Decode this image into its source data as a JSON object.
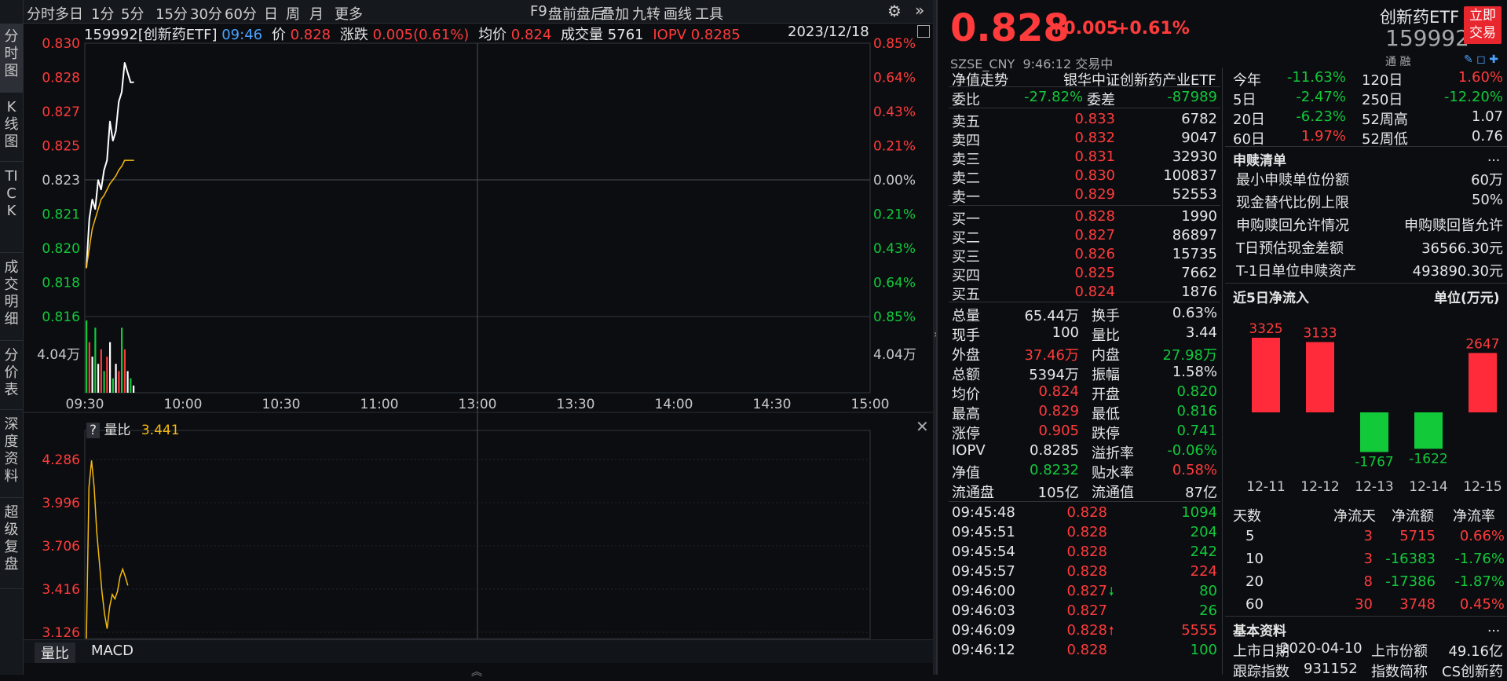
{
  "sidebar": {
    "tabs": [
      "分时图",
      "K线图",
      "TICK",
      "成交明细",
      "分价表",
      "深度资料",
      "超级复盘"
    ]
  },
  "toolbar": {
    "periods": [
      "分时",
      "多日",
      "1分",
      "5分",
      "15分",
      "30分",
      "60分",
      "日",
      "周",
      "月",
      "更多"
    ],
    "tools": [
      "F9",
      "盘前盘后",
      "叠加",
      "九转",
      "画线",
      "工具"
    ]
  },
  "infobar": {
    "code": "159992[创新药ETF]",
    "time": "09:46",
    "price_label": "价",
    "price": "0.828",
    "change_label": "涨跌",
    "change": "0.005(0.61%)",
    "avg_label": "均价",
    "avg": "0.824",
    "volume_label": "成交量",
    "volume": "5761",
    "iopv_label": "IOPV",
    "iopv": "0.8285",
    "date": "2023/12/18"
  },
  "price_axis": {
    "left": [
      "0.830",
      "0.828",
      "0.827",
      "0.825",
      "0.823",
      "0.821",
      "0.820",
      "0.818",
      "0.816"
    ],
    "right": [
      "0.85%",
      "0.64%",
      "0.43%",
      "0.21%",
      "0.00%",
      "0.21%",
      "0.43%",
      "0.64%",
      "0.85%"
    ],
    "vol_left": "4.04万",
    "vol_right": "4.04万"
  },
  "time_axis": [
    "09:30",
    "10:00",
    "10:30",
    "11:00",
    "13:00",
    "13:30",
    "14:00",
    "14:30",
    "15:00"
  ],
  "sub_chart": {
    "q": "?",
    "label": "量比",
    "value": "3.441",
    "ticks": [
      "4.286",
      "3.996",
      "3.706",
      "3.416",
      "3.126"
    ]
  },
  "bottom_tabs": [
    "量比",
    "MACD"
  ],
  "chart_data": [
    {
      "type": "line",
      "title": "",
      "ylim": [
        0.816,
        0.83
      ],
      "x": [
        "09:30",
        "09:31",
        "09:32",
        "09:33",
        "09:34",
        "09:35",
        "09:36",
        "09:37",
        "09:38",
        "09:39",
        "09:40",
        "09:41",
        "09:42",
        "09:43",
        "09:44",
        "09:45",
        "09:46"
      ],
      "series": [
        {
          "name": "价",
          "values": [
            0.8185,
            0.821,
            0.822,
            0.8215,
            0.823,
            0.8225,
            0.8235,
            0.824,
            0.826,
            0.825,
            0.8255,
            0.827,
            0.8275,
            0.829,
            0.8285,
            0.828,
            0.828
          ]
        },
        {
          "name": "均价",
          "values": [
            0.8185,
            0.8195,
            0.8205,
            0.821,
            0.8215,
            0.822,
            0.8222,
            0.8225,
            0.8228,
            0.823,
            0.8232,
            0.8235,
            0.8237,
            0.824,
            0.824,
            0.824,
            0.824
          ]
        }
      ]
    },
    {
      "type": "line",
      "title": "量比",
      "ylim": [
        2.9,
        4.35
      ],
      "x": [
        "09:30",
        "09:31",
        "09:32",
        "09:33",
        "09:34",
        "09:35",
        "09:36",
        "09:37",
        "09:38",
        "09:39",
        "09:40",
        "09:41",
        "09:42",
        "09:43",
        "09:44",
        "09:45",
        "09:46"
      ],
      "series": [
        {
          "name": "量比",
          "values": [
            2.9,
            4.1,
            4.28,
            4.1,
            3.8,
            3.6,
            3.4,
            3.25,
            3.15,
            3.3,
            3.38,
            3.35,
            3.4,
            3.5,
            3.55,
            3.5,
            3.44
          ]
        }
      ]
    },
    {
      "type": "bar",
      "title": "近5日净流入",
      "ylabel": "单位(万元)",
      "categories": [
        "12-11",
        "12-12",
        "12-13",
        "12-14",
        "12-15"
      ],
      "values": [
        3325,
        3133,
        -1767,
        -1622,
        2647
      ]
    }
  ],
  "quote": {
    "price": "0.828",
    "change": "+0.005",
    "pct": "+0.61%",
    "name": "创新药ETF",
    "code": "159992",
    "trade_btn": "立即交易",
    "market": "SZSE_CNY",
    "time": "9:46:12",
    "status": "交易中"
  },
  "nav": {
    "label": "净值走势",
    "fund": "银华中证创新药产业ETF"
  },
  "weibi": {
    "l1": "委比",
    "v1": "-27.82%",
    "l2": "委差",
    "v2": "-87989"
  },
  "asks": [
    {
      "label": "卖五",
      "price": "0.833",
      "vol": "6782"
    },
    {
      "label": "卖四",
      "price": "0.832",
      "vol": "9047"
    },
    {
      "label": "卖三",
      "price": "0.831",
      "vol": "32930"
    },
    {
      "label": "卖二",
      "price": "0.830",
      "vol": "100837"
    },
    {
      "label": "卖一",
      "price": "0.829",
      "vol": "52553"
    }
  ],
  "bids": [
    {
      "label": "买一",
      "price": "0.828",
      "vol": "1990"
    },
    {
      "label": "买二",
      "price": "0.827",
      "vol": "86897"
    },
    {
      "label": "买三",
      "price": "0.826",
      "vol": "15735"
    },
    {
      "label": "买四",
      "price": "0.825",
      "vol": "7662"
    },
    {
      "label": "买五",
      "price": "0.824",
      "vol": "1876"
    }
  ],
  "stats": [
    {
      "l1": "总量",
      "v1": "65.44万",
      "l2": "换手",
      "v2": "0.63%",
      "c1": "white",
      "c2": "white"
    },
    {
      "l1": "现手",
      "v1": "100",
      "l2": "量比",
      "v2": "3.44",
      "c1": "white",
      "c2": "white"
    },
    {
      "l1": "外盘",
      "v1": "37.46万",
      "l2": "内盘",
      "v2": "27.98万",
      "c1": "red",
      "c2": "green"
    },
    {
      "l1": "总额",
      "v1": "5394万",
      "l2": "振幅",
      "v2": "1.58%",
      "c1": "white",
      "c2": "white"
    },
    {
      "l1": "均价",
      "v1": "0.824",
      "l2": "开盘",
      "v2": "0.820",
      "c1": "red",
      "c2": "green"
    },
    {
      "l1": "最高",
      "v1": "0.829",
      "l2": "最低",
      "v2": "0.816",
      "c1": "red",
      "c2": "green"
    },
    {
      "l1": "涨停",
      "v1": "0.905",
      "l2": "跌停",
      "v2": "0.741",
      "c1": "red",
      "c2": "green"
    },
    {
      "l1": "IOPV",
      "v1": "0.8285",
      "l2": "溢折率",
      "v2": "-0.06%",
      "c1": "white",
      "c2": "green"
    },
    {
      "l1": "净值",
      "v1": "0.8232",
      "l2": "贴水率",
      "v2": "0.58%",
      "c1": "green",
      "c2": "red"
    },
    {
      "l1": "流通盘",
      "v1": "105亿",
      "l2": "流通值",
      "v2": "87亿",
      "c1": "white",
      "c2": "white"
    }
  ],
  "ticks": [
    {
      "t": "09:45:48",
      "p": "0.828",
      "v": "1094",
      "vc": "green",
      "arrow": ""
    },
    {
      "t": "09:45:51",
      "p": "0.828",
      "v": "204",
      "vc": "green",
      "arrow": ""
    },
    {
      "t": "09:45:54",
      "p": "0.828",
      "v": "242",
      "vc": "green",
      "arrow": ""
    },
    {
      "t": "09:45:57",
      "p": "0.828",
      "v": "224",
      "vc": "red",
      "arrow": ""
    },
    {
      "t": "09:46:00",
      "p": "0.827",
      "v": "80",
      "vc": "green",
      "arrow": "down"
    },
    {
      "t": "09:46:03",
      "p": "0.827",
      "v": "26",
      "vc": "green",
      "arrow": ""
    },
    {
      "t": "09:46:09",
      "p": "0.828",
      "v": "5555",
      "vc": "red",
      "arrow": "up"
    },
    {
      "t": "09:46:12",
      "p": "0.828",
      "v": "100",
      "vc": "green",
      "arrow": ""
    }
  ],
  "perf": [
    {
      "l1": "今年",
      "v1": "-11.63%",
      "c1": "green",
      "l2": "120日",
      "v2": "1.60%",
      "c2": "red"
    },
    {
      "l1": "5日",
      "v1": "-2.47%",
      "c1": "green",
      "l2": "250日",
      "v2": "-12.20%",
      "c2": "green"
    },
    {
      "l1": "20日",
      "v1": "-6.23%",
      "c1": "green",
      "l2": "52周高",
      "v2": "1.07",
      "c2": "white"
    },
    {
      "l1": "60日",
      "v1": "1.97%",
      "c1": "red",
      "l2": "52周低",
      "v2": "0.76",
      "c2": "white"
    }
  ],
  "redeem": {
    "title": "申赎清单",
    "more": "...",
    "rows": [
      {
        "l": "最小申赎单位份额",
        "v": "60万"
      },
      {
        "l": "现金替代比例上限",
        "v": "50%"
      },
      {
        "l": "申购赎回允许情况",
        "v": "申购赎回皆允许"
      },
      {
        "l": "T日预估现金差额",
        "v": "36566.30元"
      },
      {
        "l": "T-1日单位申赎资产",
        "v": "493890.30元"
      }
    ]
  },
  "flow": {
    "title": "近5日净流入",
    "unit": "单位(万元)"
  },
  "flow_table": {
    "headers": [
      "天数",
      "净流天",
      "净流额",
      "净流率"
    ],
    "rows": [
      {
        "d": "5",
        "n": "3",
        "a": "5715",
        "r": "0.66%",
        "c": "red"
      },
      {
        "d": "10",
        "n": "3",
        "a": "-16383",
        "r": "-1.76%",
        "c": "green"
      },
      {
        "d": "20",
        "n": "8",
        "a": "-17386",
        "r": "-1.87%",
        "c": "green"
      },
      {
        "d": "60",
        "n": "30",
        "a": "3748",
        "r": "0.45%",
        "c": "red"
      }
    ]
  },
  "basic": {
    "title": "基本资料",
    "more": "...",
    "r1l": "上市日期",
    "r1v": "2020-04-10",
    "r1l2": "上市份额",
    "r1v2": "49.16亿",
    "r2l": "跟踪指数",
    "r2v": "931152",
    "r2l2": "指数简称",
    "r2v2": "CS创新药"
  }
}
